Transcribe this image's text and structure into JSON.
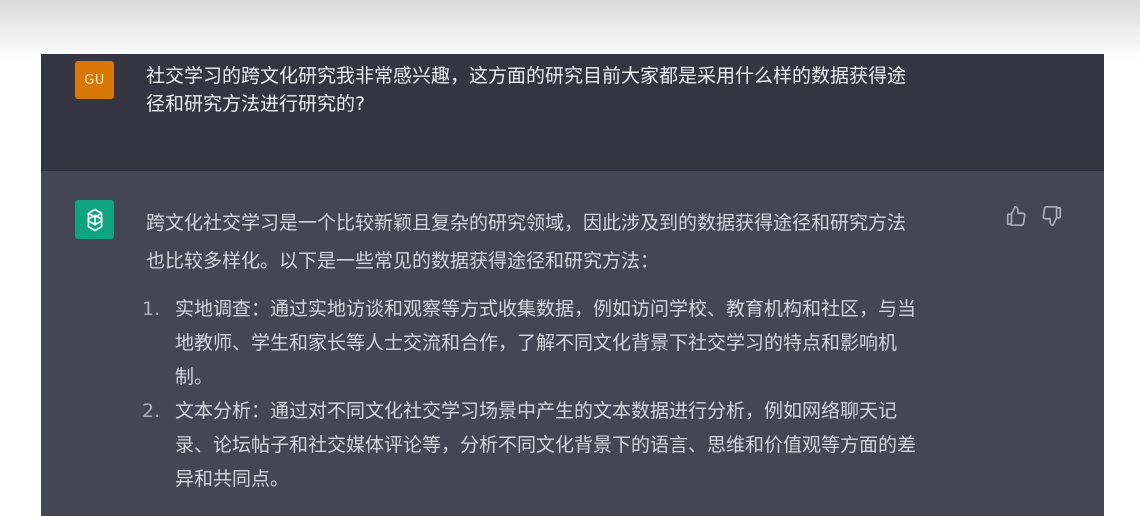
{
  "user_message": {
    "avatar_initials": "GU",
    "lines": [
      "社交学习的跨文化研究我非常感兴趣，这方面的研究目前大家都是采用什么样的数据获得途",
      "径和研究方法进行研究的?"
    ]
  },
  "assistant_message": {
    "intro_lines": [
      "跨文化社交学习是一个比较新颖且复杂的研究领域，因此涉及到的数据获得途径和研究方法",
      "也比较多样化。以下是一些常见的数据获得途径和研究方法："
    ],
    "items": [
      {
        "number": "1.",
        "lines": [
          "实地调查：通过实地访谈和观察等方式收集数据，例如访问学校、教育机构和社区，与当",
          "地教师、学生和家长等人士交流和合作，了解不同文化背景下社交学习的特点和影响机",
          "制。"
        ]
      },
      {
        "number": "2.",
        "lines": [
          "文本分析：通过对不同文化社交学习场景中产生的文本数据进行分析，例如网络聊天记",
          "录、论坛帖子和社交媒体评论等，分析不同文化背景下的语言、思维和价值观等方面的差",
          "异和共同点。"
        ]
      }
    ]
  },
  "icons": {
    "assistant_avatar": "openai-logo-icon",
    "thumbs_up": "thumbs-up-icon",
    "thumbs_down": "thumbs-down-icon"
  },
  "colors": {
    "user_bg": "#343541",
    "assistant_bg": "#444654",
    "user_avatar": "#d97706",
    "assistant_avatar": "#10a37f"
  }
}
